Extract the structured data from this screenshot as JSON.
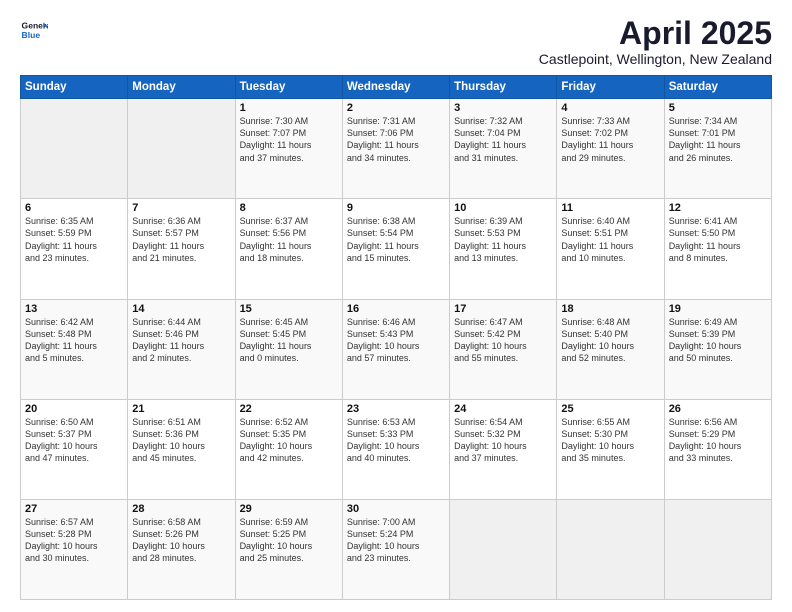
{
  "header": {
    "logo_line1": "General",
    "logo_line2": "Blue",
    "title": "April 2025",
    "subtitle": "Castlepoint, Wellington, New Zealand"
  },
  "calendar": {
    "headers": [
      "Sunday",
      "Monday",
      "Tuesday",
      "Wednesday",
      "Thursday",
      "Friday",
      "Saturday"
    ],
    "weeks": [
      [
        {
          "day": "",
          "info": ""
        },
        {
          "day": "",
          "info": ""
        },
        {
          "day": "1",
          "info": "Sunrise: 7:30 AM\nSunset: 7:07 PM\nDaylight: 11 hours\nand 37 minutes."
        },
        {
          "day": "2",
          "info": "Sunrise: 7:31 AM\nSunset: 7:06 PM\nDaylight: 11 hours\nand 34 minutes."
        },
        {
          "day": "3",
          "info": "Sunrise: 7:32 AM\nSunset: 7:04 PM\nDaylight: 11 hours\nand 31 minutes."
        },
        {
          "day": "4",
          "info": "Sunrise: 7:33 AM\nSunset: 7:02 PM\nDaylight: 11 hours\nand 29 minutes."
        },
        {
          "day": "5",
          "info": "Sunrise: 7:34 AM\nSunset: 7:01 PM\nDaylight: 11 hours\nand 26 minutes."
        }
      ],
      [
        {
          "day": "6",
          "info": "Sunrise: 6:35 AM\nSunset: 5:59 PM\nDaylight: 11 hours\nand 23 minutes."
        },
        {
          "day": "7",
          "info": "Sunrise: 6:36 AM\nSunset: 5:57 PM\nDaylight: 11 hours\nand 21 minutes."
        },
        {
          "day": "8",
          "info": "Sunrise: 6:37 AM\nSunset: 5:56 PM\nDaylight: 11 hours\nand 18 minutes."
        },
        {
          "day": "9",
          "info": "Sunrise: 6:38 AM\nSunset: 5:54 PM\nDaylight: 11 hours\nand 15 minutes."
        },
        {
          "day": "10",
          "info": "Sunrise: 6:39 AM\nSunset: 5:53 PM\nDaylight: 11 hours\nand 13 minutes."
        },
        {
          "day": "11",
          "info": "Sunrise: 6:40 AM\nSunset: 5:51 PM\nDaylight: 11 hours\nand 10 minutes."
        },
        {
          "day": "12",
          "info": "Sunrise: 6:41 AM\nSunset: 5:50 PM\nDaylight: 11 hours\nand 8 minutes."
        }
      ],
      [
        {
          "day": "13",
          "info": "Sunrise: 6:42 AM\nSunset: 5:48 PM\nDaylight: 11 hours\nand 5 minutes."
        },
        {
          "day": "14",
          "info": "Sunrise: 6:44 AM\nSunset: 5:46 PM\nDaylight: 11 hours\nand 2 minutes."
        },
        {
          "day": "15",
          "info": "Sunrise: 6:45 AM\nSunset: 5:45 PM\nDaylight: 11 hours\nand 0 minutes."
        },
        {
          "day": "16",
          "info": "Sunrise: 6:46 AM\nSunset: 5:43 PM\nDaylight: 10 hours\nand 57 minutes."
        },
        {
          "day": "17",
          "info": "Sunrise: 6:47 AM\nSunset: 5:42 PM\nDaylight: 10 hours\nand 55 minutes."
        },
        {
          "day": "18",
          "info": "Sunrise: 6:48 AM\nSunset: 5:40 PM\nDaylight: 10 hours\nand 52 minutes."
        },
        {
          "day": "19",
          "info": "Sunrise: 6:49 AM\nSunset: 5:39 PM\nDaylight: 10 hours\nand 50 minutes."
        }
      ],
      [
        {
          "day": "20",
          "info": "Sunrise: 6:50 AM\nSunset: 5:37 PM\nDaylight: 10 hours\nand 47 minutes."
        },
        {
          "day": "21",
          "info": "Sunrise: 6:51 AM\nSunset: 5:36 PM\nDaylight: 10 hours\nand 45 minutes."
        },
        {
          "day": "22",
          "info": "Sunrise: 6:52 AM\nSunset: 5:35 PM\nDaylight: 10 hours\nand 42 minutes."
        },
        {
          "day": "23",
          "info": "Sunrise: 6:53 AM\nSunset: 5:33 PM\nDaylight: 10 hours\nand 40 minutes."
        },
        {
          "day": "24",
          "info": "Sunrise: 6:54 AM\nSunset: 5:32 PM\nDaylight: 10 hours\nand 37 minutes."
        },
        {
          "day": "25",
          "info": "Sunrise: 6:55 AM\nSunset: 5:30 PM\nDaylight: 10 hours\nand 35 minutes."
        },
        {
          "day": "26",
          "info": "Sunrise: 6:56 AM\nSunset: 5:29 PM\nDaylight: 10 hours\nand 33 minutes."
        }
      ],
      [
        {
          "day": "27",
          "info": "Sunrise: 6:57 AM\nSunset: 5:28 PM\nDaylight: 10 hours\nand 30 minutes."
        },
        {
          "day": "28",
          "info": "Sunrise: 6:58 AM\nSunset: 5:26 PM\nDaylight: 10 hours\nand 28 minutes."
        },
        {
          "day": "29",
          "info": "Sunrise: 6:59 AM\nSunset: 5:25 PM\nDaylight: 10 hours\nand 25 minutes."
        },
        {
          "day": "30",
          "info": "Sunrise: 7:00 AM\nSunset: 5:24 PM\nDaylight: 10 hours\nand 23 minutes."
        },
        {
          "day": "",
          "info": ""
        },
        {
          "day": "",
          "info": ""
        },
        {
          "day": "",
          "info": ""
        }
      ]
    ]
  }
}
